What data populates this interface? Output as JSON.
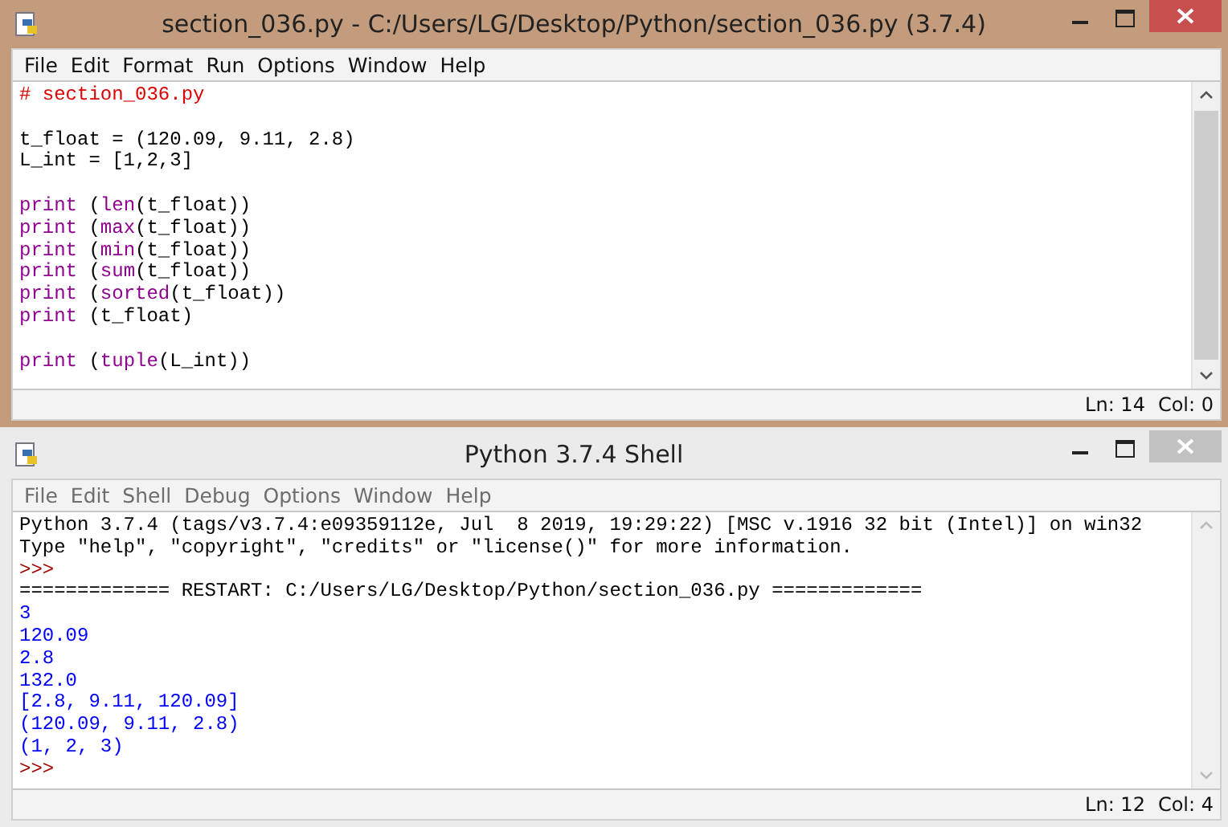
{
  "windows": [
    {
      "title": "section_036.py - C:/Users/LG/Desktop/Python/section_036.py (3.7.4)",
      "active": true,
      "menu": [
        "File",
        "Edit",
        "Format",
        "Run",
        "Options",
        "Window",
        "Help"
      ],
      "blocks": [
        {
          "lines": [
            [
              {
                "text": "# section_036.py",
                "kind": "comment"
              }
            ]
          ]
        },
        {
          "lines": [
            [
              {
                "text": "t_float = (120.09, 9.11, 2.8)",
                "kind": "plain"
              }
            ],
            [
              {
                "text": "L_int = [1,2,3]",
                "kind": "plain"
              }
            ]
          ]
        },
        {
          "lines": [
            [
              {
                "text": "print",
                "kind": "builtin"
              },
              {
                "text": " (",
                "kind": "plain"
              },
              {
                "text": "len",
                "kind": "builtin"
              },
              {
                "text": "(t_float))",
                "kind": "plain"
              }
            ],
            [
              {
                "text": "print",
                "kind": "builtin"
              },
              {
                "text": " (",
                "kind": "plain"
              },
              {
                "text": "max",
                "kind": "builtin"
              },
              {
                "text": "(t_float))",
                "kind": "plain"
              }
            ],
            [
              {
                "text": "print",
                "kind": "builtin"
              },
              {
                "text": " (",
                "kind": "plain"
              },
              {
                "text": "min",
                "kind": "builtin"
              },
              {
                "text": "(t_float))",
                "kind": "plain"
              }
            ],
            [
              {
                "text": "print",
                "kind": "builtin"
              },
              {
                "text": " (",
                "kind": "plain"
              },
              {
                "text": "sum",
                "kind": "builtin"
              },
              {
                "text": "(t_float))",
                "kind": "plain"
              }
            ],
            [
              {
                "text": "print",
                "kind": "builtin"
              },
              {
                "text": " (",
                "kind": "plain"
              },
              {
                "text": "sorted",
                "kind": "builtin"
              },
              {
                "text": "(t_float))",
                "kind": "plain"
              }
            ],
            [
              {
                "text": "print",
                "kind": "builtin"
              },
              {
                "text": " (t_float)",
                "kind": "plain"
              }
            ]
          ]
        },
        {
          "lines": [
            [
              {
                "text": "print",
                "kind": "builtin"
              },
              {
                "text": " (",
                "kind": "plain"
              },
              {
                "text": "tuple",
                "kind": "builtin"
              },
              {
                "text": "(L_int))",
                "kind": "plain"
              }
            ]
          ]
        }
      ],
      "status": {
        "ln": "Ln: 14",
        "col": "Col: 0"
      }
    },
    {
      "title": "Python 3.7.4 Shell",
      "active": false,
      "menu": [
        "File",
        "Edit",
        "Shell",
        "Debug",
        "Options",
        "Window",
        "Help"
      ],
      "blocks": [
        {
          "lines": [
            [
              {
                "text": "Python 3.7.4 (tags/v3.7.4:e09359112e, Jul  8 2019, 19:29:22) [MSC v.1916 32 bit (Intel)] on win32",
                "kind": "plain"
              }
            ],
            [
              {
                "text": "Type \"help\", \"copyright\", \"credits\" or \"license()\" for more information.",
                "kind": "plain"
              }
            ],
            [
              {
                "text": ">>>",
                "kind": "prompt"
              }
            ],
            [
              {
                "text": "============= RESTART: C:/Users/LG/Desktop/Python/section_036.py =============",
                "kind": "plain"
              }
            ],
            [
              {
                "text": "3",
                "kind": "output"
              }
            ],
            [
              {
                "text": "120.09",
                "kind": "output"
              }
            ],
            [
              {
                "text": "2.8",
                "kind": "output"
              }
            ],
            [
              {
                "text": "132.0",
                "kind": "output"
              }
            ],
            [
              {
                "text": "[2.8, 9.11, 120.09]",
                "kind": "output"
              }
            ],
            [
              {
                "text": "(120.09, 9.11, 2.8)",
                "kind": "output"
              }
            ],
            [
              {
                "text": "(1, 2, 3)",
                "kind": "output"
              }
            ],
            [
              {
                "text": ">>>",
                "kind": "prompt"
              }
            ]
          ]
        }
      ],
      "status": {
        "ln": "Ln: 12",
        "col": "Col: 4"
      }
    }
  ]
}
